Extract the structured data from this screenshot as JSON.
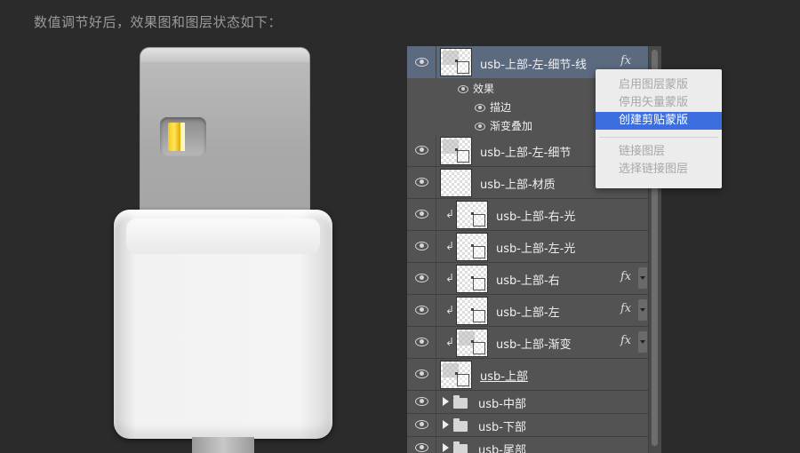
{
  "caption": "数值调节好后，效果图和图层状态如下：",
  "layers": {
    "top": {
      "name": "usb-上部-左-细节-线",
      "fx": "fx",
      "effects_label": "效果",
      "effect_items": [
        "描边",
        "渐变叠加"
      ]
    },
    "rows": [
      {
        "name": "usb-上部-左-细节"
      },
      {
        "name": "usb-上部-材质"
      },
      {
        "name": "usb-上部-右-光",
        "clip": "↲"
      },
      {
        "name": "usb-上部-左-光",
        "clip": "↲"
      },
      {
        "name": "usb-上部-右",
        "clip": "↲",
        "fx": "fx"
      },
      {
        "name": "usb-上部-左",
        "clip": "↲",
        "fx": "fx"
      },
      {
        "name": "usb-上部-渐变",
        "clip": "↲",
        "fx": "fx"
      },
      {
        "name": "usb-上部"
      }
    ],
    "groups": [
      "usb-中部",
      "usb-下部",
      "usb-尾部"
    ]
  },
  "context_menu": {
    "items": [
      "启用图层蒙版",
      "停用矢量蒙版",
      "创建剪贴蒙版",
      "链接图层",
      "选择链接图层"
    ],
    "highlighted": "创建剪贴蒙版",
    "highlight_color": "#3b6fe0"
  }
}
